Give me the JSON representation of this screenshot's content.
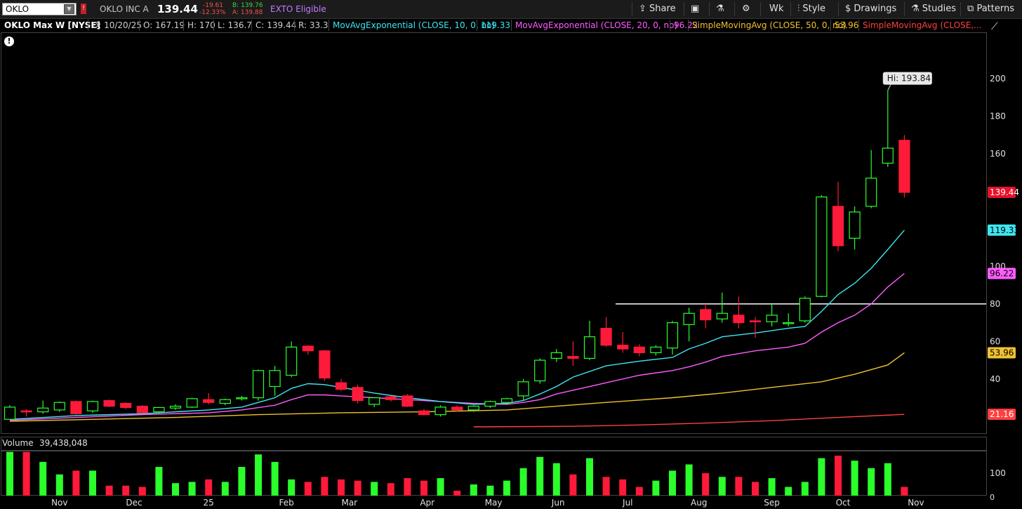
{
  "toolbar": {
    "symbol": "OKLO",
    "company": "OKLO INC A",
    "last": "139.44",
    "change": "-19.61",
    "change_pct": "-12.33%",
    "bid": "B: 139.76",
    "ask": "A: 139.88",
    "exto": "EXTO Eligible",
    "share": "Share",
    "timeframe": "Wk",
    "style": "Style",
    "drawings": "Drawings",
    "studies": "Studies",
    "patterns": "Patterns"
  },
  "studybar": {
    "title": "OKLO Max W [NYSE]",
    "date": "D: 10/20/25",
    "open": "O: 167.19",
    "high": "H: 170",
    "low": "L: 136.7",
    "close": "C: 139.44",
    "range": "R: 33.3",
    "ema10_label": "MovAvgExponential (CLOSE, 10, 0, no)",
    "ema10_value": "119.33",
    "ema20_label": "MovAvgExponential (CLOSE, 20, 0, no)",
    "ema20_value": "96.22",
    "sma50_label": "SimpleMovingAvg (CLOSE, 50, 0, no)",
    "sma50_value": "53.96",
    "sma200_label": "SimpleMovingAvg (CLOSE,..."
  },
  "volume_panel": {
    "label": "Volume",
    "value": "39,438,048"
  },
  "colors": {
    "up": "#2bff2b",
    "down": "#ff1a3a",
    "ema10": "#3fe6f0",
    "ema20": "#ff5cff",
    "sma50": "#f0c232",
    "sma200": "#ff4040",
    "last_price_tag": "#e8102a"
  },
  "chart_data": {
    "type": "candlestick",
    "interval": "weekly",
    "y_axis": {
      "min": 10,
      "max": 210,
      "ticks": [
        20,
        40,
        60,
        80,
        100,
        120,
        140,
        160,
        180,
        200
      ],
      "tick_labels": [
        "",
        "40",
        "60",
        "80",
        "100",
        "",
        "140",
        "160",
        "180",
        "200"
      ]
    },
    "x_axis_labels": [
      "Nov",
      "Dec",
      "25",
      "Feb",
      "Mar",
      "Apr",
      "May",
      "Jun",
      "Jul",
      "Aug",
      "Sep",
      "Oct",
      "Nov"
    ],
    "x_axis_label_weeks": [
      3,
      7.5,
      12,
      16.7,
      20.5,
      25.2,
      29.2,
      33.1,
      37.3,
      41.6,
      46,
      50.3,
      54.7
    ],
    "candles": [
      {
        "o": 18.5,
        "h": 26,
        "l": 18.5,
        "c": 25
      },
      {
        "o": 23,
        "h": 24,
        "l": 20,
        "c": 22.8
      },
      {
        "o": 22.5,
        "h": 28.5,
        "l": 21.5,
        "c": 24.5
      },
      {
        "o": 23.5,
        "h": 28,
        "l": 22.5,
        "c": 27.5
      },
      {
        "o": 28,
        "h": 28.5,
        "l": 21,
        "c": 21.5
      },
      {
        "o": 23,
        "h": 28.5,
        "l": 22,
        "c": 28
      },
      {
        "o": 28.5,
        "h": 29,
        "l": 25,
        "c": 25.5
      },
      {
        "o": 27,
        "h": 27.5,
        "l": 24,
        "c": 24.8
      },
      {
        "o": 25.5,
        "h": 26,
        "l": 21.5,
        "c": 22
      },
      {
        "o": 22.5,
        "h": 25,
        "l": 21.5,
        "c": 24.8
      },
      {
        "o": 24.5,
        "h": 26.5,
        "l": 23.5,
        "c": 25.5
      },
      {
        "o": 25,
        "h": 30,
        "l": 24.5,
        "c": 29.5
      },
      {
        "o": 29,
        "h": 32.5,
        "l": 26.5,
        "c": 27.5
      },
      {
        "o": 27,
        "h": 29.5,
        "l": 26,
        "c": 29
      },
      {
        "o": 29.5,
        "h": 31,
        "l": 28.5,
        "c": 30
      },
      {
        "o": 30,
        "h": 45,
        "l": 28.5,
        "c": 44.5
      },
      {
        "o": 36,
        "h": 47,
        "l": 31,
        "c": 44.5
      },
      {
        "o": 42,
        "h": 60,
        "l": 41,
        "c": 57
      },
      {
        "o": 57.5,
        "h": 58,
        "l": 53,
        "c": 55
      },
      {
        "o": 55,
        "h": 55.5,
        "l": 39,
        "c": 40.5
      },
      {
        "o": 38,
        "h": 40,
        "l": 33.5,
        "c": 34.5
      },
      {
        "o": 35.5,
        "h": 37,
        "l": 27,
        "c": 28.5
      },
      {
        "o": 26.5,
        "h": 30,
        "l": 25,
        "c": 30
      },
      {
        "o": 30.5,
        "h": 31,
        "l": 28,
        "c": 29
      },
      {
        "o": 31,
        "h": 32,
        "l": 25,
        "c": 25.5
      },
      {
        "o": 23,
        "h": 24,
        "l": 20.5,
        "c": 21
      },
      {
        "o": 21,
        "h": 26,
        "l": 20,
        "c": 25
      },
      {
        "o": 25,
        "h": 26,
        "l": 22.5,
        "c": 23.5
      },
      {
        "o": 23.5,
        "h": 26,
        "l": 22.5,
        "c": 25.5
      },
      {
        "o": 25.5,
        "h": 28.5,
        "l": 24.5,
        "c": 28
      },
      {
        "o": 27.5,
        "h": 30,
        "l": 26.5,
        "c": 29.5
      },
      {
        "o": 31,
        "h": 40,
        "l": 28.5,
        "c": 38.5
      },
      {
        "o": 39,
        "h": 51,
        "l": 37.5,
        "c": 50
      },
      {
        "o": 51,
        "h": 56,
        "l": 49,
        "c": 54
      },
      {
        "o": 52,
        "h": 60,
        "l": 47,
        "c": 51
      },
      {
        "o": 51,
        "h": 71,
        "l": 50,
        "c": 62.5
      },
      {
        "o": 67,
        "h": 73,
        "l": 57,
        "c": 58
      },
      {
        "o": 58,
        "h": 65,
        "l": 54,
        "c": 56
      },
      {
        "o": 57,
        "h": 58.5,
        "l": 52,
        "c": 54
      },
      {
        "o": 54,
        "h": 58,
        "l": 52.5,
        "c": 57
      },
      {
        "o": 56.5,
        "h": 71,
        "l": 53,
        "c": 70
      },
      {
        "o": 69,
        "h": 78,
        "l": 60,
        "c": 75
      },
      {
        "o": 77,
        "h": 80,
        "l": 67,
        "c": 71.5
      },
      {
        "o": 72,
        "h": 86,
        "l": 70,
        "c": 75
      },
      {
        "o": 74,
        "h": 84,
        "l": 67,
        "c": 70
      },
      {
        "o": 71,
        "h": 73,
        "l": 62,
        "c": 70.5
      },
      {
        "o": 70.5,
        "h": 80,
        "l": 68,
        "c": 74
      },
      {
        "o": 70,
        "h": 75,
        "l": 68,
        "c": 70
      },
      {
        "o": 71,
        "h": 84,
        "l": 70,
        "c": 83
      },
      {
        "o": 84,
        "h": 138,
        "l": 83.5,
        "c": 137
      },
      {
        "o": 132,
        "h": 145,
        "l": 108,
        "c": 111
      },
      {
        "o": 115,
        "h": 132,
        "l": 109,
        "c": 129
      },
      {
        "o": 132,
        "h": 162,
        "l": 131,
        "c": 147
      },
      {
        "o": 155,
        "h": 193.84,
        "l": 153,
        "c": 163
      },
      {
        "o": 167.19,
        "h": 170,
        "l": 136.7,
        "c": 139.44
      }
    ],
    "ema10": [
      [
        0,
        18.5
      ],
      [
        4,
        20.5
      ],
      [
        8,
        21.5
      ],
      [
        12,
        23.5
      ],
      [
        14,
        25
      ],
      [
        16,
        30
      ],
      [
        17,
        35
      ],
      [
        18,
        37.5
      ],
      [
        19,
        37
      ],
      [
        20,
        35.5
      ],
      [
        22,
        32.5
      ],
      [
        24,
        30
      ],
      [
        26,
        28
      ],
      [
        28,
        26.5
      ],
      [
        30,
        27
      ],
      [
        31,
        28.5
      ],
      [
        32,
        32
      ],
      [
        33,
        36
      ],
      [
        34,
        41
      ],
      [
        36,
        47
      ],
      [
        38,
        49.5
      ],
      [
        40,
        51.5
      ],
      [
        41,
        56
      ],
      [
        42,
        59
      ],
      [
        43,
        62.5
      ],
      [
        45,
        64.5
      ],
      [
        47,
        67
      ],
      [
        48,
        68
      ],
      [
        49,
        76
      ],
      [
        50,
        85
      ],
      [
        51,
        91
      ],
      [
        52,
        99
      ],
      [
        53,
        109
      ],
      [
        54,
        119.33
      ]
    ],
    "ema20": [
      [
        0,
        18
      ],
      [
        4,
        19.5
      ],
      [
        8,
        21
      ],
      [
        12,
        22
      ],
      [
        14,
        23.5
      ],
      [
        16,
        26
      ],
      [
        17,
        29
      ],
      [
        18,
        31.5
      ],
      [
        19,
        31.5
      ],
      [
        20,
        31
      ],
      [
        22,
        30
      ],
      [
        24,
        29
      ],
      [
        26,
        28
      ],
      [
        28,
        27
      ],
      [
        30,
        26.5
      ],
      [
        31,
        27.5
      ],
      [
        32,
        29
      ],
      [
        33,
        32
      ],
      [
        34,
        34
      ],
      [
        36,
        38
      ],
      [
        38,
        42
      ],
      [
        40,
        44.5
      ],
      [
        41,
        46.5
      ],
      [
        42,
        49
      ],
      [
        43,
        52
      ],
      [
        45,
        55
      ],
      [
        47,
        57
      ],
      [
        48,
        59
      ],
      [
        49,
        65
      ],
      [
        50,
        70
      ],
      [
        51,
        74
      ],
      [
        52,
        80
      ],
      [
        53,
        89
      ],
      [
        54,
        96.22
      ]
    ],
    "sma50": [
      [
        0,
        17.5
      ],
      [
        5,
        18.5
      ],
      [
        10,
        19.5
      ],
      [
        15,
        21
      ],
      [
        20,
        22
      ],
      [
        25,
        22.5
      ],
      [
        30,
        23.5
      ],
      [
        33,
        25.5
      ],
      [
        36,
        27.5
      ],
      [
        40,
        30
      ],
      [
        43,
        32.5
      ],
      [
        46,
        35.5
      ],
      [
        49,
        38.5
      ],
      [
        51,
        42.5
      ],
      [
        53,
        47.5
      ],
      [
        54,
        53.96
      ]
    ],
    "sma200": [
      [
        28,
        14.5
      ],
      [
        34,
        14.8
      ],
      [
        38,
        15.5
      ],
      [
        42,
        16.5
      ],
      [
        46,
        17.8
      ],
      [
        50,
        19.5
      ],
      [
        54,
        21.16
      ]
    ],
    "horizontal_line": 80,
    "price_tags": [
      {
        "label": "139.44",
        "value": 139.44
      },
      {
        "label": "119.33",
        "value": 119.33
      },
      {
        "label": "96.22",
        "value": 96.22
      },
      {
        "label": "53.96",
        "value": 53.96
      },
      {
        "label": "21.16",
        "value": 21.16
      }
    ],
    "high_annotation": "Hi: 193.84",
    "volume": {
      "tick_labels": [
        "100",
        "0"
      ],
      "values": [
        35,
        35,
        27,
        17,
        20,
        20,
        8,
        8,
        7,
        23,
        10,
        11,
        13,
        11,
        23,
        33,
        27,
        13,
        11,
        15,
        13,
        12,
        11,
        10,
        14,
        12,
        14,
        4,
        9,
        8,
        12,
        22,
        31,
        26,
        17,
        30,
        15,
        13,
        7,
        12,
        20,
        25,
        18,
        15,
        15,
        11,
        14,
        7,
        11,
        30,
        32,
        28,
        22,
        26,
        7
      ]
    }
  }
}
